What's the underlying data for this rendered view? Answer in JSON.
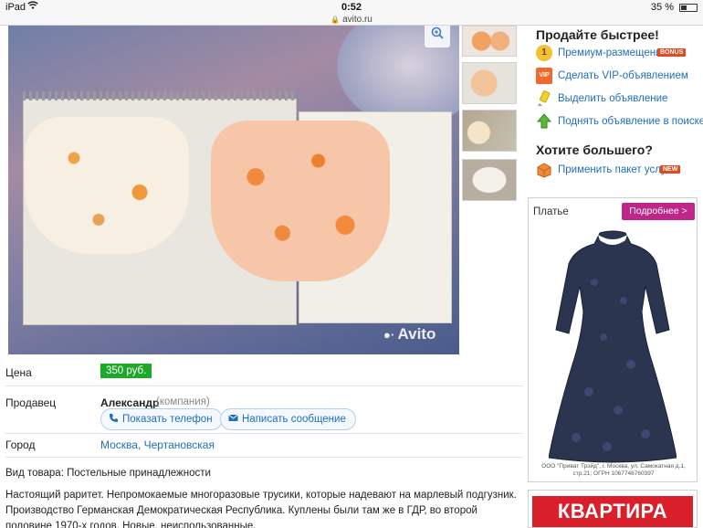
{
  "status_bar": {
    "device": "iPad",
    "time": "0:52",
    "battery": "35 %",
    "url": "avito.ru"
  },
  "photo": {
    "watermark": "Avito"
  },
  "promo": {
    "title": "Продайте быстрее!",
    "items": [
      {
        "label": "Премиум-размещение",
        "badge": "BONUS",
        "icon": "medal-icon"
      },
      {
        "label": "Сделать VIP-объявлением",
        "icon": "vip-icon"
      },
      {
        "label": "Выделить объявление",
        "icon": "highlighter-icon"
      },
      {
        "label": "Поднять объявление в поиске",
        "icon": "arrow-up-icon"
      }
    ],
    "more_title": "Хотите большего?",
    "package": {
      "label": "Применить пакет услуг",
      "badge": "NEW",
      "icon": "package-icon"
    }
  },
  "ad": {
    "title": "Платье",
    "button": "Подробнее >",
    "legal": "ООО \"Приват Трэйд\", г. Москва, ул. Самокатная д.1, стр.21; ОГРН 1067746760397"
  },
  "ad2": {
    "text": "КВАРТИРА"
  },
  "details": {
    "price_label": "Цена",
    "price": "350 руб.",
    "seller_label": "Продавец",
    "seller_name": "Александр",
    "seller_type": "(компания)",
    "show_phone": "Показать телефон",
    "write_message": "Написать сообщение",
    "city_label": "Город",
    "city": "Москва, Чертановская",
    "goods_type": "Вид товара: Постельные принадлежности",
    "description": "Настоящий раритет. Непромокаемые многоразовые трусики, которые надевают на марлевый подгузник. Производство Германская Демократическая Республика. Куплены были там же в ГДР, во второй половине 1970-х годов. Новые, неиспользованные."
  }
}
